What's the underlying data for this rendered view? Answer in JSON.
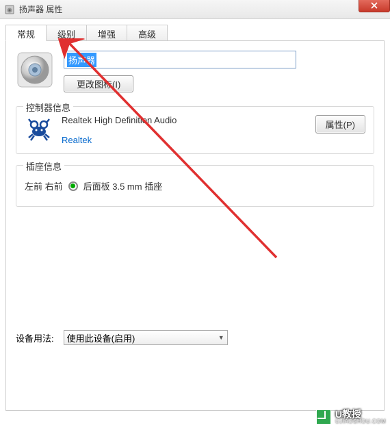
{
  "window": {
    "title": "扬声器 属性"
  },
  "tabs": {
    "general": "常规",
    "levels": "级别",
    "enhance": "增强",
    "advanced": "高级"
  },
  "device": {
    "name": "扬声器",
    "change_icon_btn": "更改图标(I)"
  },
  "controller": {
    "legend": "控制器信息",
    "name": "Realtek High Definition Audio",
    "vendor": "Realtek",
    "props_btn": "属性(P)"
  },
  "jack": {
    "legend": "插座信息",
    "position": "左前 右前",
    "desc": "后面板 3.5 mm 插座"
  },
  "usage": {
    "label": "设备用法:",
    "selected": "使用此设备(启用)"
  },
  "watermark": {
    "main": "U教授",
    "sub": "UJIAOSHOU.COM"
  }
}
